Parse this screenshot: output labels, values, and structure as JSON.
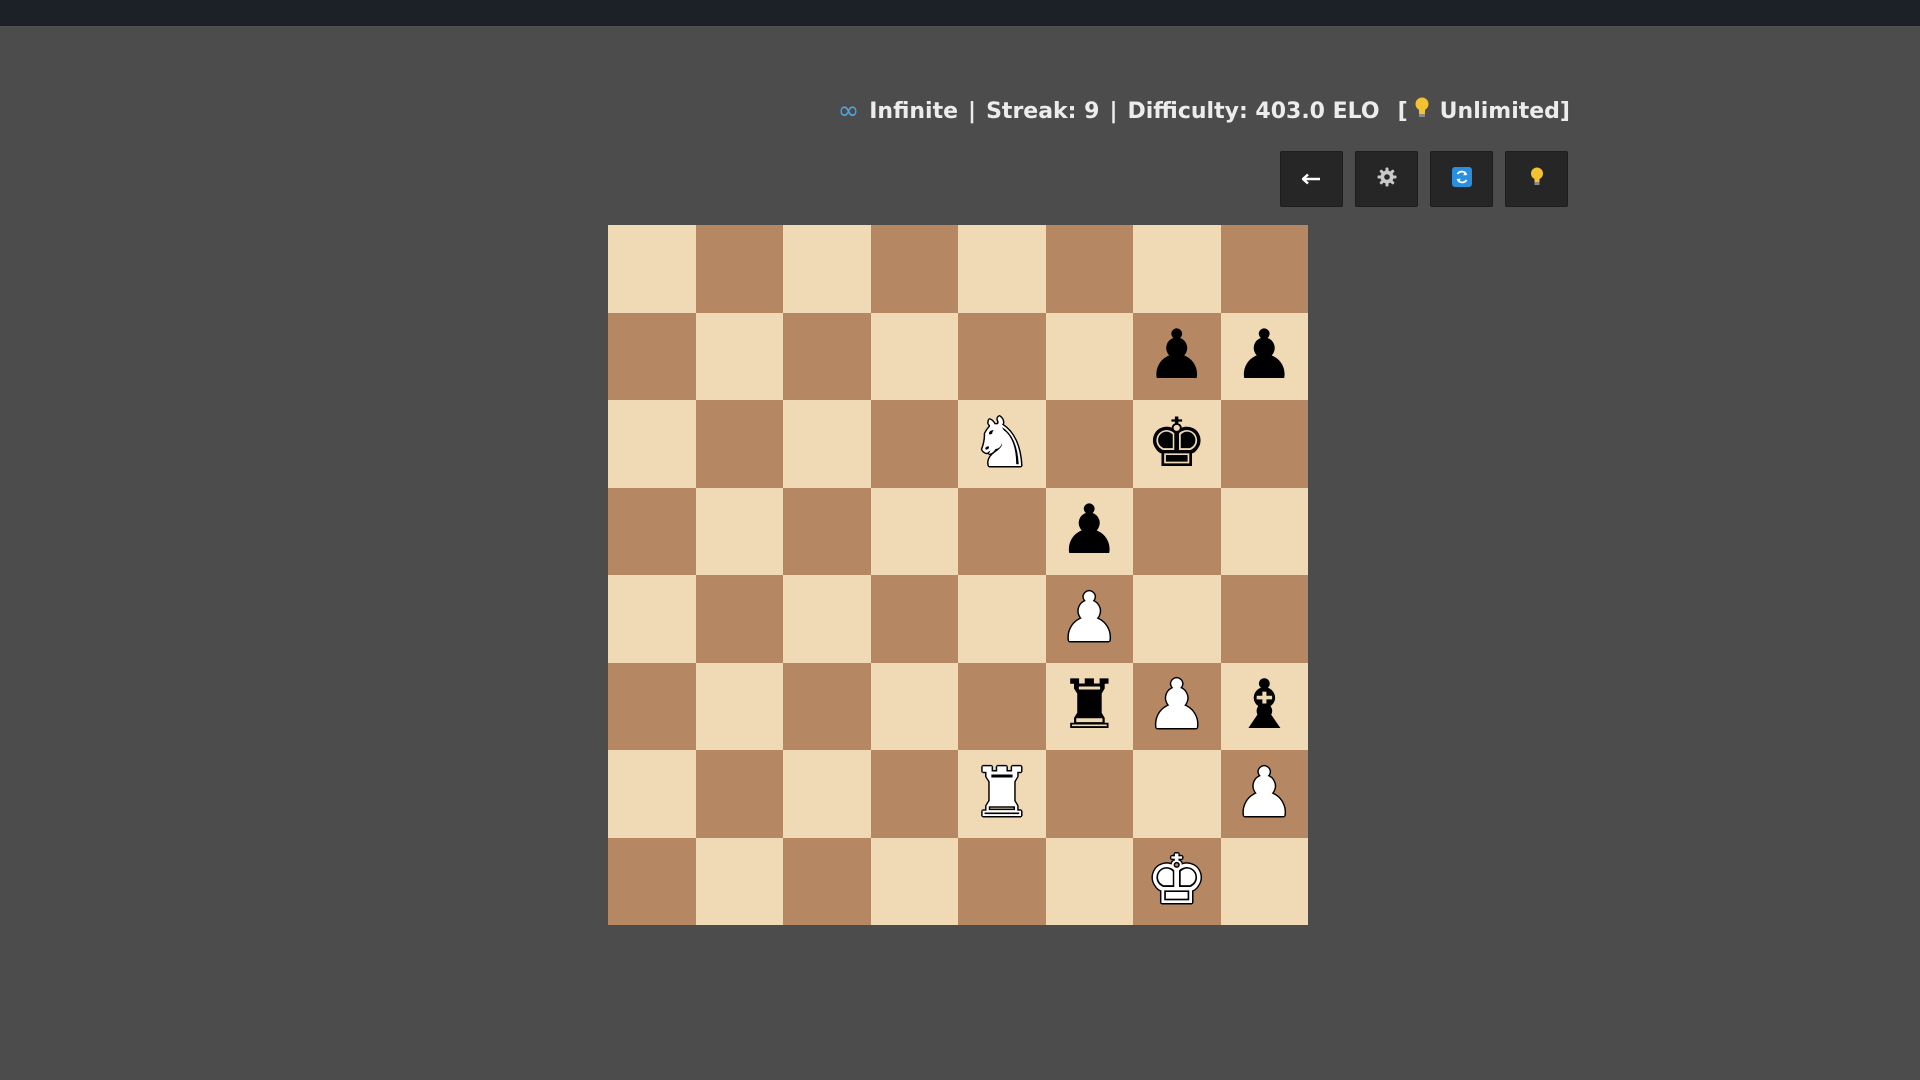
{
  "status": {
    "mode_icon": "infinity-icon",
    "mode": "Infinite",
    "sep1": "|",
    "streak": "Streak: 9",
    "sep2": "|",
    "difficulty": "Difficulty: 403.0 ELO",
    "hints_open": "[",
    "hint_icon": "lightbulb-icon",
    "hints": "Unlimited]"
  },
  "toolbar": [
    {
      "name": "back-button",
      "icon": "arrow-left-icon"
    },
    {
      "name": "settings-button",
      "icon": "gear-icon"
    },
    {
      "name": "flip-board-button",
      "icon": "refresh-icon"
    },
    {
      "name": "hint-button",
      "icon": "lightbulb-icon"
    }
  ],
  "colors": {
    "light_square": "#f0d9b5",
    "dark_square": "#b58863",
    "background": "#4c4c4c",
    "topbar": "#1b2127",
    "accent_blue": "#4aa6e6",
    "bulb_yellow": "#f2c232"
  },
  "board": {
    "orientation": "white-bottom",
    "ranks": [
      [
        "",
        "",
        "",
        "",
        "",
        "",
        "",
        ""
      ],
      [
        "",
        "",
        "",
        "",
        "",
        "",
        "bp",
        "bp"
      ],
      [
        "",
        "",
        "",
        "",
        "wn",
        "",
        "bk",
        ""
      ],
      [
        "",
        "",
        "",
        "",
        "",
        "bp",
        "",
        ""
      ],
      [
        "",
        "",
        "",
        "",
        "",
        "wp",
        "",
        ""
      ],
      [
        "",
        "",
        "",
        "",
        "",
        "br",
        "wp",
        "bb"
      ],
      [
        "",
        "",
        "",
        "",
        "wr",
        "",
        "",
        "wp"
      ],
      [
        "",
        "",
        "",
        "",
        "",
        "",
        "wk",
        ""
      ]
    ]
  }
}
